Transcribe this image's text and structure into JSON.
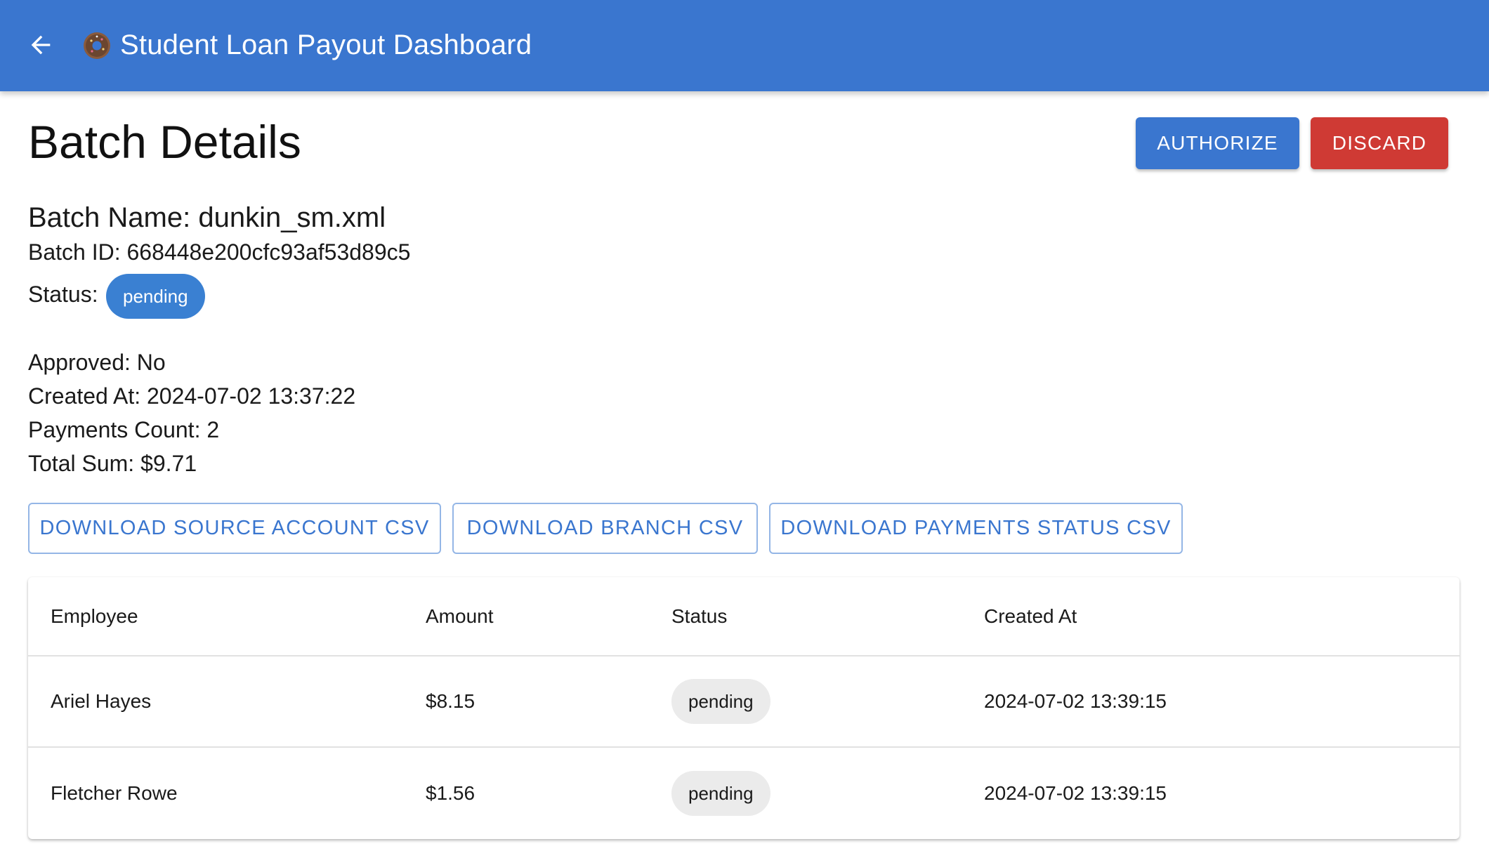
{
  "appbar": {
    "back_icon": "arrow-left-icon",
    "logo_icon": "donut-icon",
    "title": "Student Loan Payout Dashboard",
    "color": "#3a76cf"
  },
  "page": {
    "title": "Batch Details"
  },
  "actions": {
    "authorize_label": "AUTHORIZE",
    "discard_label": "DISCARD",
    "authorize_color": "#3a76cf",
    "discard_color": "#cf3a34"
  },
  "batch": {
    "name_line": "Batch Name: dunkin_sm.xml",
    "id_line": "Batch ID: 668448e200cfc93af53d89c5",
    "status_label": "Status:",
    "status_value": "pending",
    "approved_line": "Approved: No",
    "created_line": "Created At: 2024-07-02 13:37:22",
    "payments_count_line": "Payments Count: 2",
    "total_sum_line": "Total Sum: $9.71"
  },
  "downloads": {
    "source_label": "DOWNLOAD SOURCE ACCOUNT CSV",
    "branch_label": "DOWNLOAD BRANCH CSV",
    "payments_label": "DOWNLOAD PAYMENTS STATUS CSV"
  },
  "table": {
    "columns": [
      "Employee",
      "Amount",
      "Status",
      "Created At"
    ],
    "rows": [
      {
        "employee": "Ariel Hayes",
        "amount": "$8.15",
        "status": "pending",
        "created_at": "2024-07-02 13:39:15"
      },
      {
        "employee": "Fletcher Rowe",
        "amount": "$1.56",
        "status": "pending",
        "created_at": "2024-07-02 13:39:15"
      }
    ]
  }
}
